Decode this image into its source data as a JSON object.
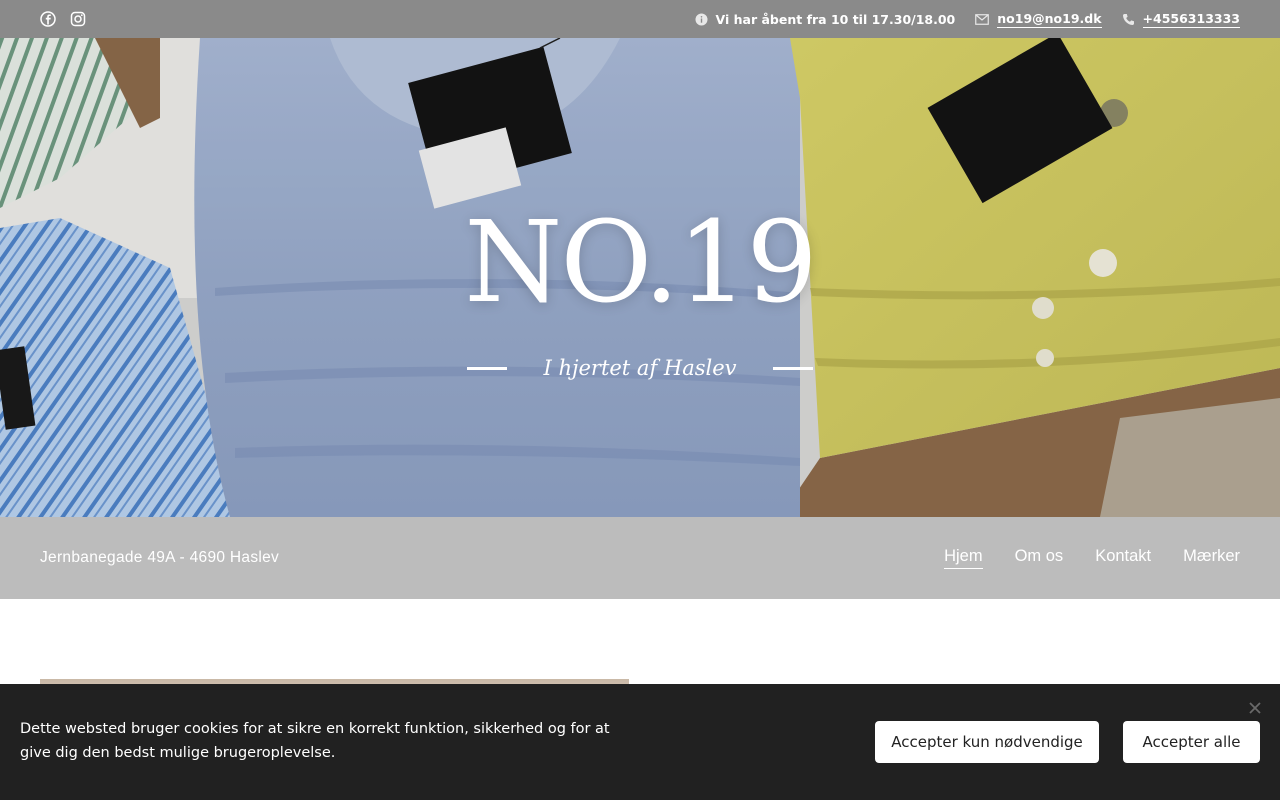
{
  "topbar": {
    "socials": [
      {
        "icon": "facebook-icon"
      },
      {
        "icon": "instagram-icon"
      }
    ],
    "hours": "Vi har åbent fra 10 til 17.30/18.00",
    "email": "no19@no19.dk",
    "phone": "+4556313333"
  },
  "hero": {
    "title": "NO.19",
    "subtitle": "I hjertet af Haslev"
  },
  "navbar": {
    "address": "Jernbanegade 49A - 4690 Haslev",
    "items": [
      {
        "label": "Hjem",
        "active": true
      },
      {
        "label": "Om os",
        "active": false
      },
      {
        "label": "Kontakt",
        "active": false
      },
      {
        "label": "Mærker",
        "active": false
      }
    ]
  },
  "cookie": {
    "text": "Dette websted bruger cookies for at sikre en korrekt funktion, sikkerhed og for at give dig den bedst mulige brugeroplevelse.",
    "accept_necessary": "Accepter kun nødvendige",
    "accept_all": "Accepter alle"
  },
  "colors": {
    "topbar": "#8a8a8a",
    "navbar": "#bcbcbc",
    "cookie_bg": "#212121"
  }
}
